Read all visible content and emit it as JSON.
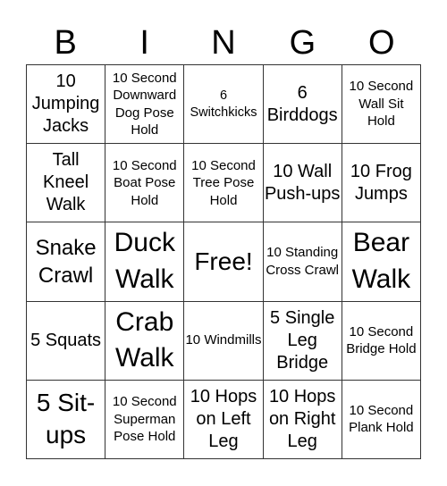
{
  "header": {
    "letters": [
      "B",
      "I",
      "N",
      "G",
      "O"
    ]
  },
  "cells": [
    "10 Jumping Jacks",
    "10 Second Downward Dog Pose Hold",
    "6 Switchkicks",
    "6 Birddogs",
    "10 Second Wall Sit Hold",
    "Tall Kneel Walk",
    "10 Second Boat Pose Hold",
    "10 Second Tree Pose Hold",
    "10 Wall Push-ups",
    "10 Frog Jumps",
    "Snake Crawl",
    "Duck Walk",
    "Free!",
    "10 Standing Cross Crawl",
    "Bear Walk",
    "5 Squats",
    "Crab Walk",
    "10 Windmills",
    "5 Single Leg Bridge",
    "10 Second Bridge Hold",
    "5 Sit-ups",
    "10 Second Superman Pose Hold",
    "10 Hops on Left Leg",
    "10 Hops on Right Leg",
    "10 Second Plank Hold"
  ]
}
